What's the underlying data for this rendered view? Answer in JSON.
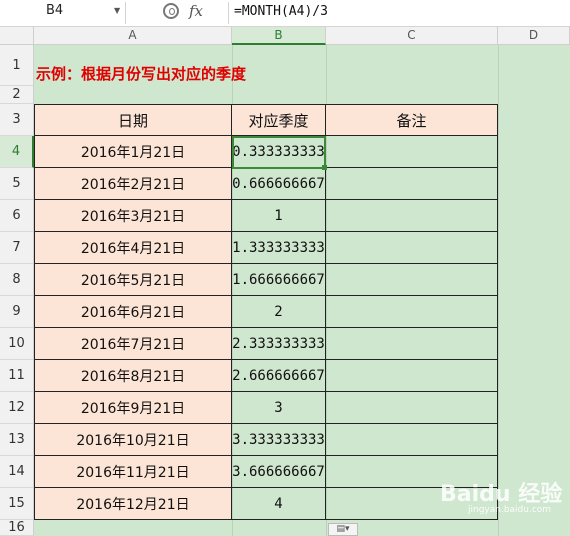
{
  "name_box": "B4",
  "formula": "=MONTH(A4)/3",
  "columns": [
    "A",
    "B",
    "C",
    "D"
  ],
  "row_numbers": [
    "1",
    "2",
    "3",
    "4",
    "5",
    "6",
    "7",
    "8",
    "9",
    "10",
    "11",
    "12",
    "13",
    "14",
    "15",
    "16"
  ],
  "title": "示例：根据月份写出对应的季度",
  "table_headers": [
    "日期",
    "对应季度",
    "备注"
  ],
  "rows": [
    {
      "date": "2016年1月21日",
      "quarter": "0.333333333"
    },
    {
      "date": "2016年2月21日",
      "quarter": "0.666666667"
    },
    {
      "date": "2016年3月21日",
      "quarter": "1"
    },
    {
      "date": "2016年4月21日",
      "quarter": "1.333333333"
    },
    {
      "date": "2016年5月21日",
      "quarter": "1.666666667"
    },
    {
      "date": "2016年6月21日",
      "quarter": "2"
    },
    {
      "date": "2016年7月21日",
      "quarter": "2.333333333"
    },
    {
      "date": "2016年8月21日",
      "quarter": "2.666666667"
    },
    {
      "date": "2016年9月21日",
      "quarter": "3"
    },
    {
      "date": "2016年10月21日",
      "quarter": "3.333333333"
    },
    {
      "date": "2016年11月21日",
      "quarter": "3.666666667"
    },
    {
      "date": "2016年12月21日",
      "quarter": "4"
    }
  ],
  "watermark": "Baidu 经验",
  "watermark_sub": "jingyan.baidu.com",
  "icons": {
    "zoom": "zoom-icon",
    "fx": "fx-icon",
    "dropdown": "chevron-down-icon",
    "paste_options": "paste-options-icon"
  },
  "colors": {
    "date_fill": "#fce4d6",
    "sheet_bg": "#cfe6cf",
    "title": "#e00000",
    "selection": "#3a8a3a"
  }
}
